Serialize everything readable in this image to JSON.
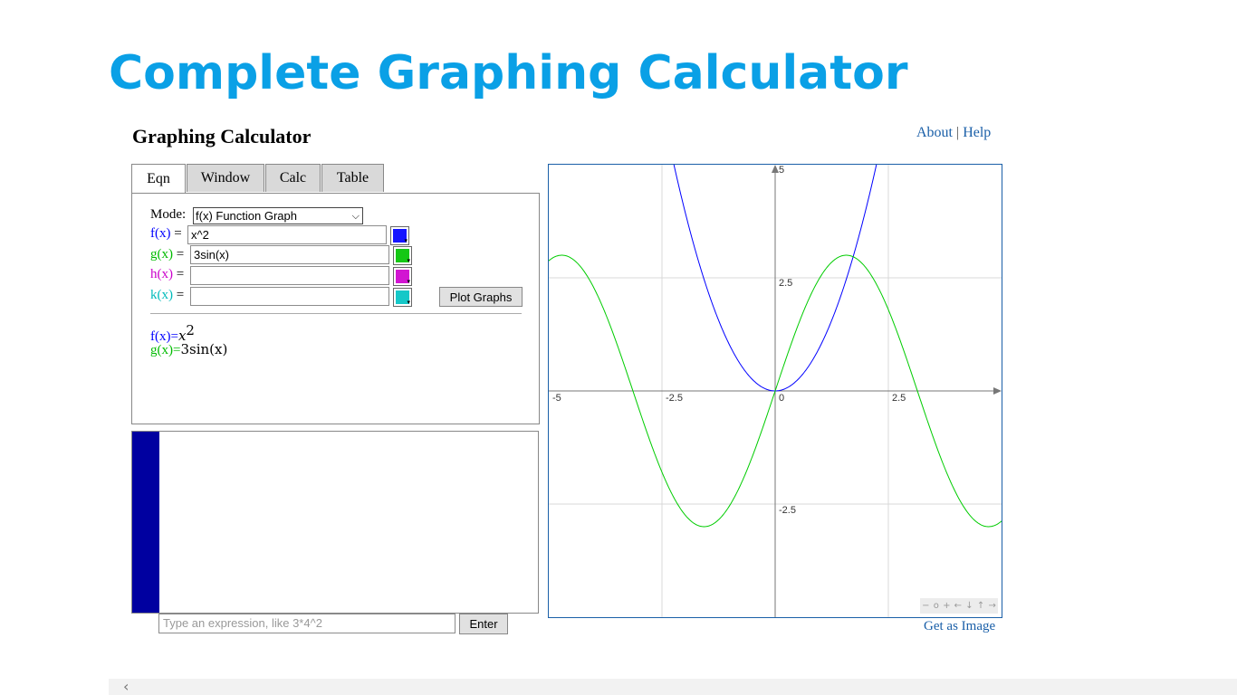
{
  "app": {
    "title": "Complete Graphing Calculator"
  },
  "page": {
    "title": "Graphing Calculator"
  },
  "links": {
    "about": "About",
    "separator": "|",
    "help": "Help"
  },
  "tabs": [
    {
      "label": "Eqn"
    },
    {
      "label": "Window"
    },
    {
      "label": "Calc"
    },
    {
      "label": "Table"
    }
  ],
  "mode": {
    "label": "Mode:",
    "value": "f(x) Function Graph"
  },
  "equations": [
    {
      "name": "f(x)",
      "eq": "=",
      "value": "x^2",
      "color": "#0000ff"
    },
    {
      "name": "g(x)",
      "eq": "=",
      "value": "3sin(x)",
      "color": "#00bb00"
    },
    {
      "name": "h(x)",
      "eq": "=",
      "value": "",
      "color": "#cc00cc"
    },
    {
      "name": "k(x)",
      "eq": "=",
      "value": "",
      "color": "#00bbbb"
    }
  ],
  "plot_button": "Plot Graphs",
  "rendered": [
    {
      "name": "f(x)=",
      "expr": "x",
      "sup": "2"
    },
    {
      "name": "g(x)=",
      "expr": "3sin(x)"
    }
  ],
  "console": {
    "placeholder": "Type an expression, like 3*4^2",
    "enter": "Enter"
  },
  "graph": {
    "tick_labels": {
      "x_neg5": "-5",
      "x_neg25": "-2.5",
      "x_0": "0",
      "x_25": "2.5",
      "y_5": "5",
      "y_25": "2.5",
      "y_neg25": "-2.5"
    },
    "nav": [
      "−",
      "o",
      "+",
      "←",
      "↓",
      "↑",
      "→"
    ],
    "get_image": "Get as Image"
  },
  "chart_data": {
    "type": "line",
    "xlim": [
      -5,
      5
    ],
    "ylim": [
      -5,
      5
    ],
    "grid": true,
    "series": [
      {
        "name": "f(x)",
        "expression": "x^2",
        "color": "#0000ff"
      },
      {
        "name": "g(x)",
        "expression": "3sin(x)",
        "color": "#00cc00"
      }
    ],
    "x_ticks": [
      -5,
      -2.5,
      0,
      2.5
    ],
    "y_ticks": [
      5,
      2.5,
      -2.5
    ]
  },
  "scroll": {
    "left_icon": "‹"
  }
}
